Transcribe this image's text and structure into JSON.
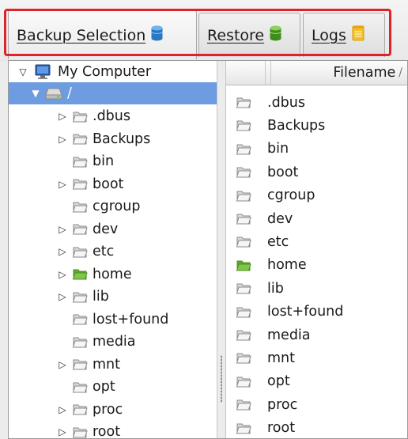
{
  "tabs": [
    {
      "label_pre": "",
      "label_u": "B",
      "label_post": "ackup Selection",
      "icon": "database-blue-icon",
      "active": true
    },
    {
      "label_pre": "",
      "label_u": "R",
      "label_post": "estore",
      "icon": "database-green-icon",
      "active": false
    },
    {
      "label_pre": "",
      "label_u": "L",
      "label_post": "ogs",
      "icon": "notepad-icon",
      "active": false
    }
  ],
  "colors": {
    "highlight": "#e0232b",
    "selection": "#6e9ce0",
    "folder_green": "#6bbf3a"
  },
  "tree": {
    "root": "My Computer",
    "drive": "/",
    "items": [
      {
        "label": ".dbus",
        "expandable": true
      },
      {
        "label": "Backups",
        "expandable": true
      },
      {
        "label": "bin",
        "expandable": false
      },
      {
        "label": "boot",
        "expandable": true
      },
      {
        "label": "cgroup",
        "expandable": false
      },
      {
        "label": "dev",
        "expandable": true
      },
      {
        "label": "etc",
        "expandable": true
      },
      {
        "label": "home",
        "expandable": true,
        "green": true
      },
      {
        "label": "lib",
        "expandable": true
      },
      {
        "label": "lost+found",
        "expandable": false
      },
      {
        "label": "media",
        "expandable": false
      },
      {
        "label": "mnt",
        "expandable": true
      },
      {
        "label": "opt",
        "expandable": false
      },
      {
        "label": "proc",
        "expandable": true
      },
      {
        "label": "root",
        "expandable": true
      }
    ]
  },
  "list": {
    "header": "Filename",
    "sort_indicator": "/",
    "rows": [
      {
        "name": ".dbus"
      },
      {
        "name": "Backups"
      },
      {
        "name": "bin"
      },
      {
        "name": "boot"
      },
      {
        "name": "cgroup"
      },
      {
        "name": "dev"
      },
      {
        "name": "etc"
      },
      {
        "name": "home",
        "green": true
      },
      {
        "name": "lib"
      },
      {
        "name": "lost+found"
      },
      {
        "name": "media"
      },
      {
        "name": "mnt"
      },
      {
        "name": "opt"
      },
      {
        "name": "proc"
      },
      {
        "name": "root"
      }
    ]
  }
}
